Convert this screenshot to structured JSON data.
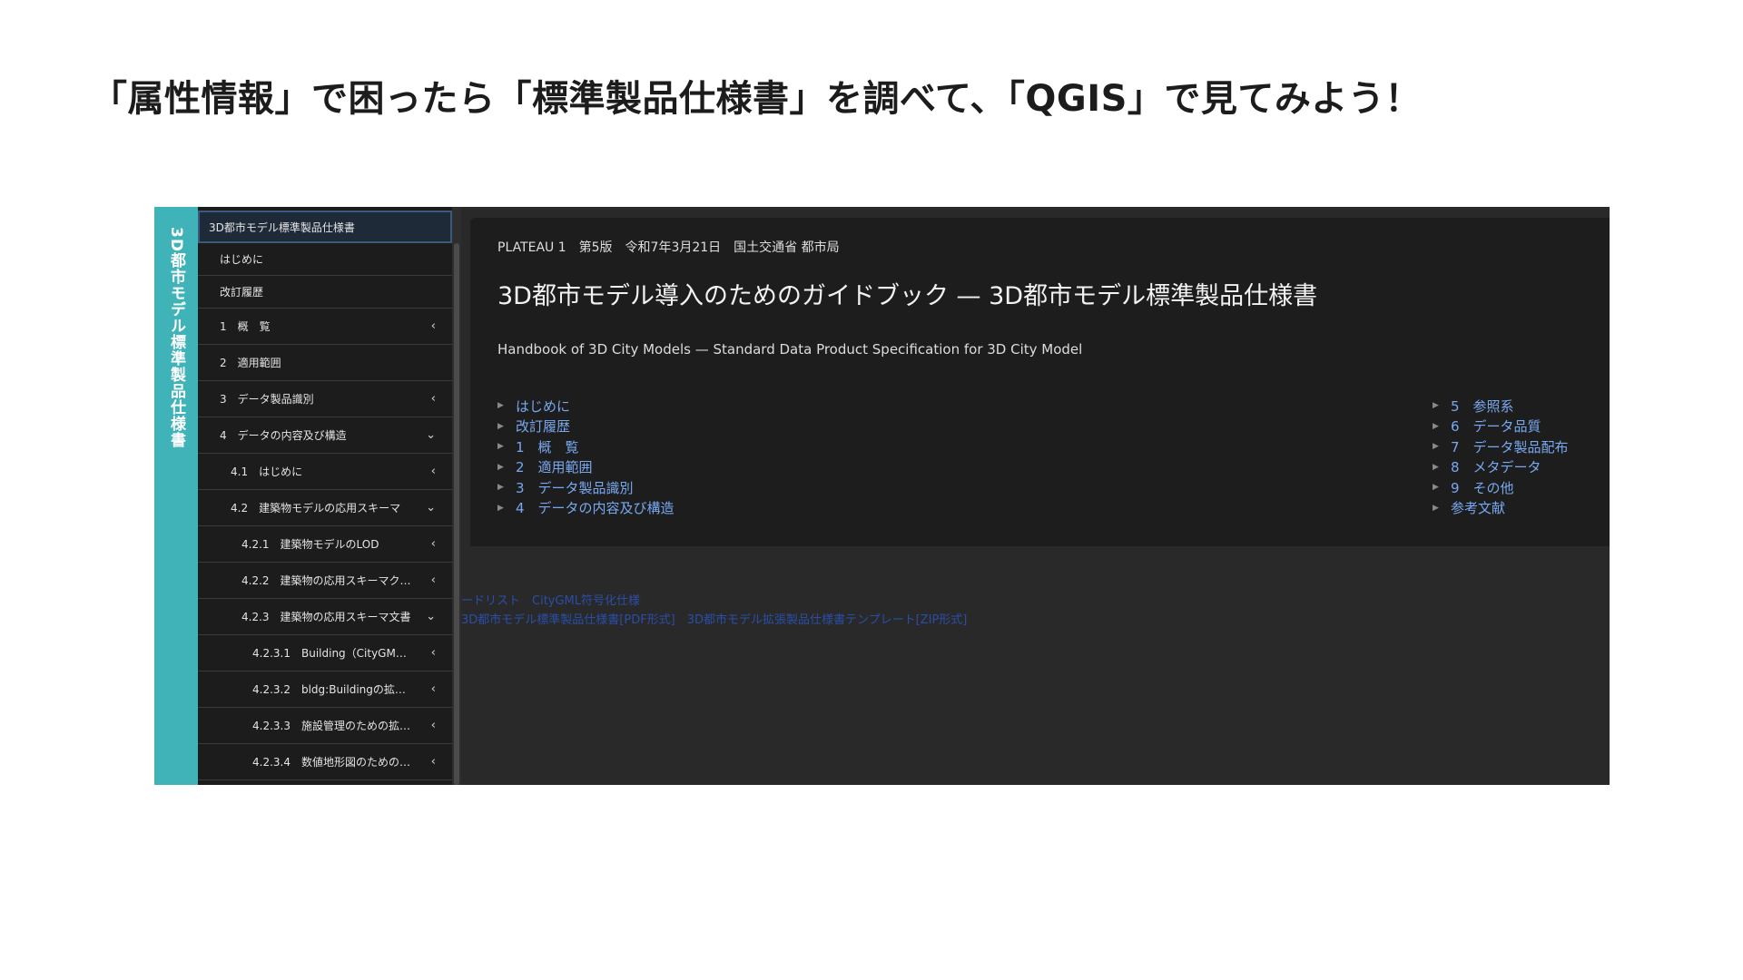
{
  "slide": {
    "title": "「属性情報」で困ったら「標準製品仕様書」を調べて、「QGIS」で見てみよう！"
  },
  "app": {
    "vertical_title": "3D都市モデル標準製品仕様書",
    "sidebar": {
      "items": [
        {
          "label": "3D都市モデル標準製品仕様書",
          "level": 0,
          "chevron": "",
          "selected": true
        },
        {
          "label": "はじめに",
          "level": 1,
          "chevron": "",
          "selected": false
        },
        {
          "label": "改訂履歴",
          "level": 1,
          "chevron": "",
          "selected": false
        },
        {
          "label": "1　概　覧",
          "level": 1,
          "chevron": "‹",
          "selected": false
        },
        {
          "label": "2　適用範囲",
          "level": 1,
          "chevron": "",
          "selected": false
        },
        {
          "label": "3　データ製品識別",
          "level": 1,
          "chevron": "‹",
          "selected": false
        },
        {
          "label": "4　データの内容及び構造",
          "level": 1,
          "chevron": "⌄",
          "selected": false
        },
        {
          "label": "4.1　はじめに",
          "level": 2,
          "chevron": "‹",
          "selected": false
        },
        {
          "label": "4.2　建築物モデルの応用スキーマ",
          "level": 2,
          "chevron": "⌄",
          "selected": false
        },
        {
          "label": "4.2.1　建築物モデルのLOD",
          "level": 3,
          "chevron": "‹",
          "selected": false
        },
        {
          "label": "4.2.2　建築物の応用スキーマク…",
          "level": 3,
          "chevron": "‹",
          "selected": false
        },
        {
          "label": "4.2.3　建築物の応用スキーマ文書",
          "level": 3,
          "chevron": "⌄",
          "selected": false
        },
        {
          "label": "4.2.3.1　Building（CityGM…",
          "level": 4,
          "chevron": "‹",
          "selected": false
        },
        {
          "label": "4.2.3.2　bldg:Buildingの拡…",
          "level": 4,
          "chevron": "‹",
          "selected": false
        },
        {
          "label": "4.2.3.3　施設管理のための拡…",
          "level": 4,
          "chevron": "‹",
          "selected": false
        },
        {
          "label": "4.2.3.4　数値地形図のための…",
          "level": 4,
          "chevron": "‹",
          "selected": false
        }
      ]
    },
    "main": {
      "meta": "PLATEAU 1　第5版　令和7年3月21日　国土交通省 都市局",
      "title": "3D都市モデル導入のためのガイドブック — 3D都市モデル標準製品仕様書",
      "subtitle": "Handbook of 3D City Models — Standard Data Product Specification for 3D City Model",
      "toc_left": [
        "はじめに",
        "改訂履歴",
        "1　概　覧",
        "2　適用範囲",
        "3　データ製品識別",
        "4　データの内容及び構造"
      ],
      "toc_right": [
        "5　参照系",
        "6　データ品質",
        "7　データ製品配布",
        "8　メタデータ",
        "9　その他",
        "参考文献"
      ],
      "ghost_links": [
        "ードリスト　CityGML符号化仕様",
        "3D都市モデル標準製品仕様書[PDF形式]　3D都市モデル拡張製品仕様書テンプレート[ZIP形式]"
      ]
    }
  },
  "colors": {
    "accent_teal": "#3fb3b8",
    "link_blue": "#78a8f0",
    "panel_bg": "#1d1d1d"
  }
}
